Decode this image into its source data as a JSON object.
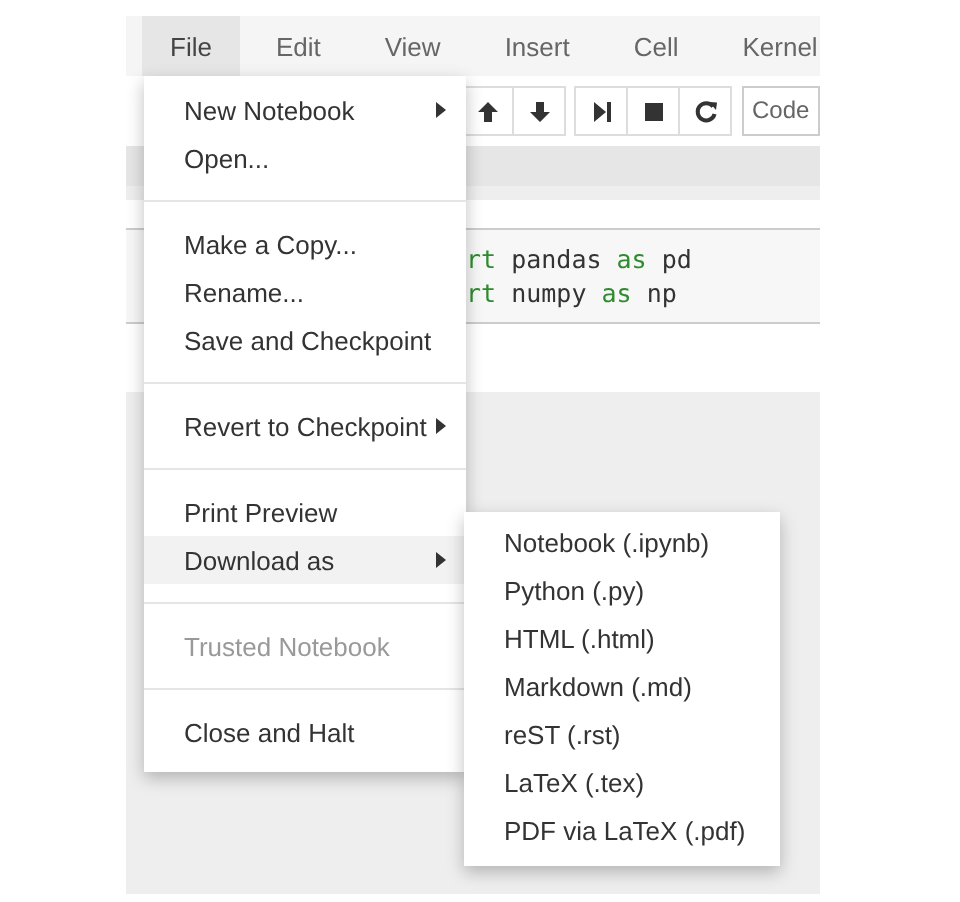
{
  "menubar": [
    {
      "label": "File",
      "selected": true
    },
    {
      "label": "Edit",
      "selected": false
    },
    {
      "label": "View",
      "selected": false
    },
    {
      "label": "Insert",
      "selected": false
    },
    {
      "label": "Cell",
      "selected": false
    },
    {
      "label": "Kernel",
      "selected": false
    }
  ],
  "toolbar": {
    "groups": [
      [
        {
          "kind": "up"
        },
        {
          "kind": "down"
        }
      ],
      [
        {
          "kind": "run"
        },
        {
          "kind": "stop"
        },
        {
          "kind": "restart"
        }
      ]
    ],
    "cell_type": "Code"
  },
  "code_cell": {
    "lines": [
      [
        {
          "text": "rt",
          "kind": "keyword"
        },
        {
          "text": " pandas ",
          "kind": "plain"
        },
        {
          "text": "as",
          "kind": "keyword"
        },
        {
          "text": " pd",
          "kind": "plain"
        }
      ],
      [
        {
          "text": "rt",
          "kind": "keyword"
        },
        {
          "text": " numpy ",
          "kind": "plain"
        },
        {
          "text": "as",
          "kind": "keyword"
        },
        {
          "text": " np",
          "kind": "plain"
        }
      ]
    ]
  },
  "file_menu": {
    "items": [
      {
        "kind": "item",
        "label": "New Notebook",
        "submenu": true,
        "selected": false,
        "disabled": false
      },
      {
        "kind": "item",
        "label": "Open...",
        "submenu": false,
        "selected": false,
        "disabled": false
      },
      {
        "kind": "separator"
      },
      {
        "kind": "item",
        "label": "Make a Copy...",
        "submenu": false,
        "selected": false,
        "disabled": false
      },
      {
        "kind": "item",
        "label": "Rename...",
        "submenu": false,
        "selected": false,
        "disabled": false
      },
      {
        "kind": "item",
        "label": "Save and Checkpoint",
        "submenu": false,
        "selected": false,
        "disabled": false
      },
      {
        "kind": "separator"
      },
      {
        "kind": "item",
        "label": "Revert to Checkpoint",
        "submenu": true,
        "selected": false,
        "disabled": false
      },
      {
        "kind": "separator"
      },
      {
        "kind": "item",
        "label": "Print Preview",
        "submenu": false,
        "selected": false,
        "disabled": false
      },
      {
        "kind": "item",
        "label": "Download as",
        "submenu": true,
        "selected": true,
        "disabled": false
      },
      {
        "kind": "separator"
      },
      {
        "kind": "item",
        "label": "Trusted Notebook",
        "submenu": false,
        "selected": false,
        "disabled": true
      },
      {
        "kind": "separator"
      },
      {
        "kind": "item",
        "label": "Close and Halt",
        "submenu": false,
        "selected": false,
        "disabled": false
      }
    ]
  },
  "download_submenu": {
    "items": [
      {
        "label": "Notebook (.ipynb)"
      },
      {
        "label": "Python (.py)"
      },
      {
        "label": "HTML (.html)"
      },
      {
        "label": "Markdown (.md)"
      },
      {
        "label": "reST (.rst)"
      },
      {
        "label": "LaTeX (.tex)"
      },
      {
        "label": "PDF via LaTeX (.pdf)"
      }
    ]
  }
}
